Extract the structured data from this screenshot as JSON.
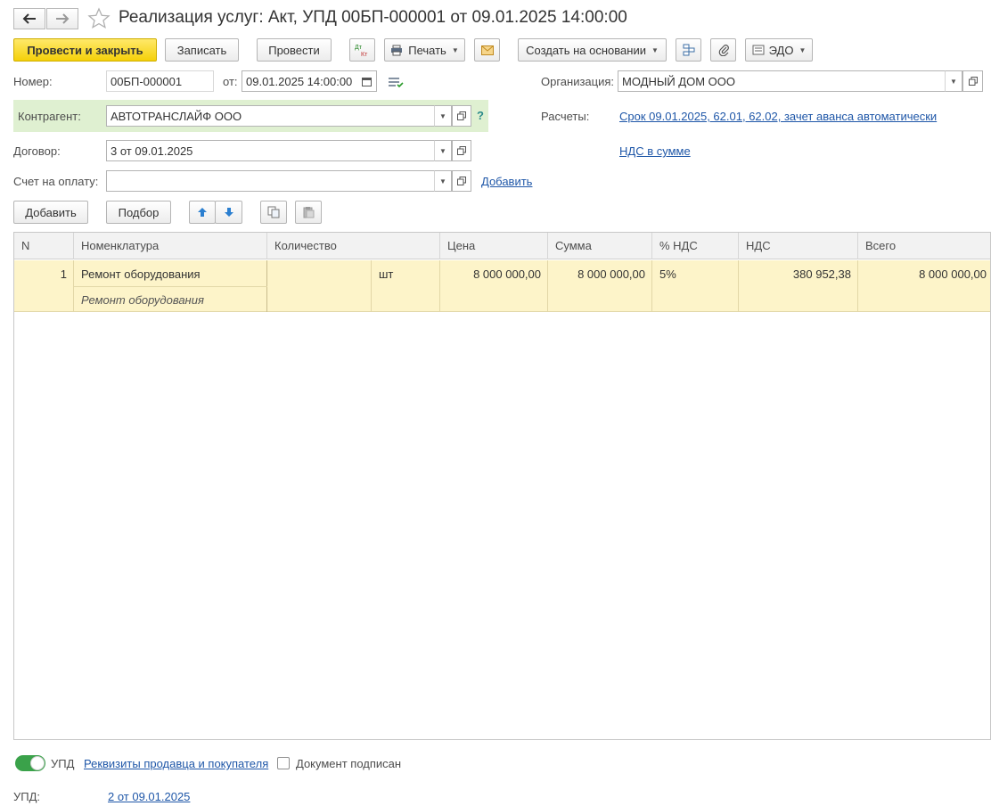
{
  "window": {
    "title": "Реализация услуг: Акт, УПД 00БП-000001 от 09.01.2025 14:00:00"
  },
  "toolbar": {
    "post_and_close": "Провести и закрыть",
    "save": "Записать",
    "post": "Провести",
    "dt_kt_icon": "Дт Кт",
    "print": "Печать",
    "create_based_on": "Создать на основании",
    "edo": "ЭДО"
  },
  "header": {
    "number_label": "Номер:",
    "number_value": "00БП-000001",
    "date_label": "от:",
    "date_value": "09.01.2025 14:00:00",
    "organization_label": "Организация:",
    "organization_value": "МОДНЫЙ ДОМ ООО",
    "counterparty_label": "Контрагент:",
    "counterparty_value": "АВТОТРАНСЛАЙФ ООО",
    "help_mark": "?",
    "settlements_label": "Расчеты:",
    "settlements_link": "Срок 09.01.2025, 62.01, 62.02, зачет аванса автоматически",
    "contract_label": "Договор:",
    "contract_value": "3 от 09.01.2025",
    "vat_link": "НДС в сумме",
    "invoice_label": "Счет на оплату:",
    "invoice_value": "",
    "invoice_add_link": "Добавить"
  },
  "table_toolbar": {
    "add": "Добавить",
    "pick": "Подбор"
  },
  "table": {
    "columns": [
      "N",
      "Номенклатура",
      "Количество",
      "Цена",
      "Сумма",
      "% НДС",
      "НДС",
      "Всего"
    ],
    "rows": [
      {
        "n": "1",
        "item": "Ремонт оборудования",
        "item_content": "Ремонт оборудования",
        "quantity": "",
        "unit": "шт",
        "price": "8 000 000,00",
        "sum": "8 000 000,00",
        "vat_rate": "5%",
        "vat": "380 952,38",
        "total": "8 000 000,00"
      }
    ]
  },
  "footer": {
    "upd_toggle_label": "УПД",
    "upd_toggle_on": true,
    "requisites_link": "Реквизиты продавца и покупателя",
    "signed_label": "Документ подписан",
    "signed_checked": false,
    "upd_label": "УПД:",
    "upd_link": "2 от 09.01.2025"
  },
  "colors": {
    "primary_button": "#f5d009",
    "counterparty_band": "#dff0d1",
    "selected_row": "#fdf4c9",
    "link": "#1f57a8",
    "toggle_on": "#3aa24a"
  }
}
